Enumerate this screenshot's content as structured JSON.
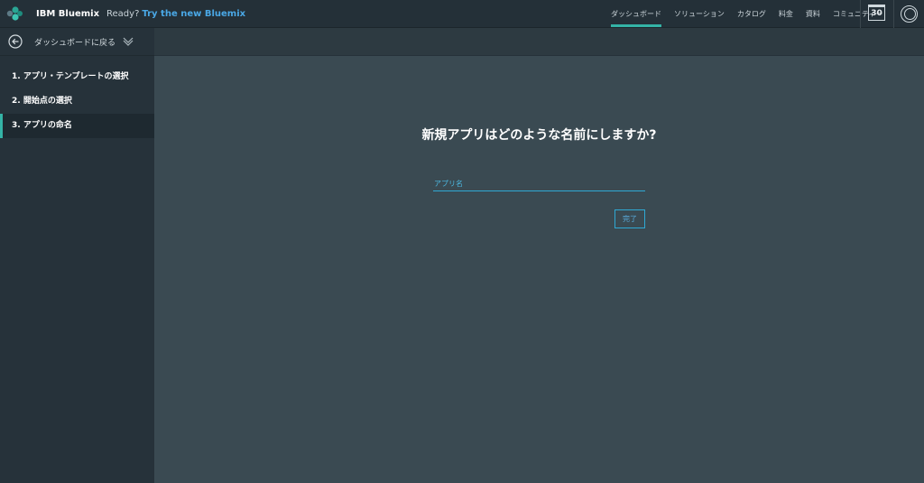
{
  "header": {
    "brand": "IBM Bluemix",
    "ready_text": "Ready?",
    "try_link": "Try the new Bluemix",
    "nav": [
      {
        "label": "ダッシュボード",
        "active": true
      },
      {
        "label": "ソリューション",
        "active": false
      },
      {
        "label": "カタログ",
        "active": false
      },
      {
        "label": "料金",
        "active": false
      },
      {
        "label": "資料",
        "active": false
      },
      {
        "label": "コミュニティー",
        "active": false
      }
    ],
    "calendar_day": "30",
    "icons": [
      "bluemix-logo-icon",
      "calendar-icon",
      "user-avatar-icon"
    ]
  },
  "sidebar": {
    "back_label": "ダッシュボードに戻る",
    "steps": [
      {
        "label": "1. アプリ・テンプレートの選択",
        "active": false
      },
      {
        "label": "2. 開始点の選択",
        "active": false
      },
      {
        "label": "3. アプリの命名",
        "active": true
      }
    ]
  },
  "main": {
    "question": "新規アプリはどのような名前にしますか?",
    "app_name_placeholder": "アプリ名",
    "done_label": "完了"
  },
  "colors": {
    "accent_teal": "#34b3a6",
    "link_blue": "#4aa8e6",
    "input_blue": "#2fa9d4",
    "background": "#3a4a52"
  }
}
